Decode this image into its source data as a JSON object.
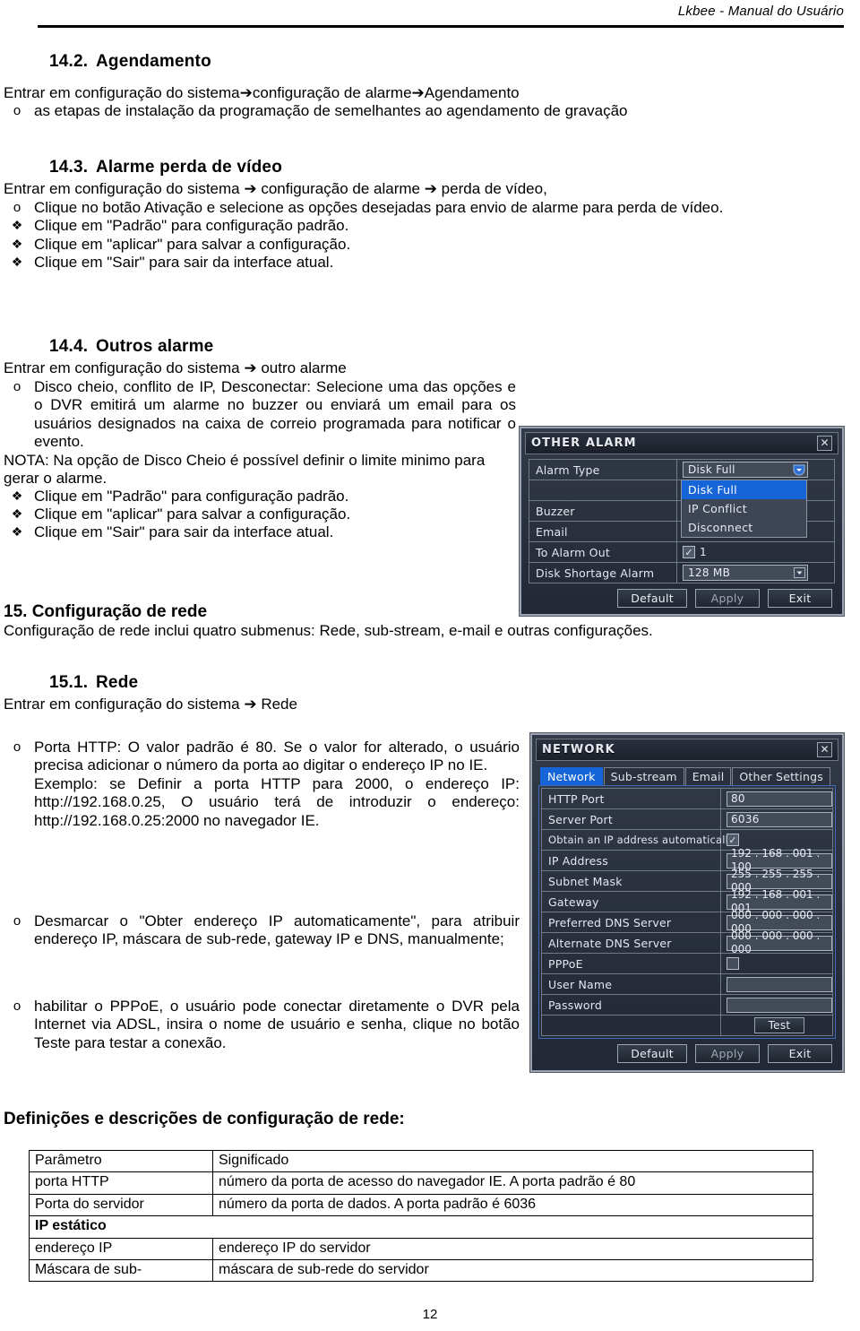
{
  "header": {
    "running_title": "Lkbee - Manual do Usuário"
  },
  "page_number": "12",
  "sections": {
    "s14_2": {
      "number": "14.2.",
      "title": "Agendamento",
      "intro": "Entrar em configuração do sistema➔configuração de alarme➔Agendamento",
      "bullets": [
        {
          "marker": "o",
          "text": "as etapas de instalação da programação de semelhantes ao agendamento de gravação"
        }
      ]
    },
    "s14_3": {
      "number": "14.3.",
      "title": "Alarme perda de vídeo",
      "intro": "Entrar em configuração do sistema ➔ configuração de alarme ➔ perda de vídeo,",
      "bullets": [
        {
          "marker": "o",
          "text": "Clique no botão Ativação e selecione as opções desejadas para envio de alarme para perda de vídeo."
        },
        {
          "marker": "❖",
          "text": "Clique em \"Padrão\" para configuração padrão."
        },
        {
          "marker": "❖",
          "text": "Clique em \"aplicar\" para salvar a configuração."
        },
        {
          "marker": "❖",
          "text": "Clique em \"Sair\" para sair da interface atual."
        }
      ]
    },
    "s14_4": {
      "number": "14.4.",
      "title": "Outros alarme",
      "intro": "Entrar em configuração do sistema ➔ outro alarme",
      "bullet_main": "Disco cheio, conflito de IP, Desconectar: Selecione uma das opções e o DVR emitirá um alarme no buzzer ou enviará um email para os usuários designados na caixa de correio programada para notificar o evento.",
      "note": "NOTA: Na opção de Disco Cheio é possível definir o limite minimo para gerar o alarme.",
      "bullets": [
        {
          "marker": "❖",
          "text": "Clique em \"Padrão\" para configuração padrão."
        },
        {
          "marker": "❖",
          "text": "Clique em \"aplicar\" para salvar a configuração."
        },
        {
          "marker": "❖",
          "text": "Clique em \"Sair\" para sair da interface atual."
        }
      ]
    },
    "s15": {
      "number": "15.",
      "title": "Configuração de rede",
      "intro": "Configuração de rede inclui quatro submenus: Rede, sub-stream, e-mail e outras configurações."
    },
    "s15_1": {
      "number": "15.1.",
      "title": "Rede",
      "intro": "Entrar em configuração do sistema ➔ Rede",
      "bullets": [
        {
          "marker": "o",
          "text": "Porta HTTP: O valor padrão é 80. Se o valor for alterado, o usuário precisa adicionar o número da porta ao digitar o endereço IP no IE."
        },
        {
          "marker": "",
          "text": "Exemplo: se  Definir a porta HTTP para 2000, o endereço IP: http://192.168.0.25, O usuário terá de introduzir o endereço: http://192.168.0.25:2000 no navegador IE."
        },
        {
          "marker": "o",
          "text": "Desmarcar o \"Obter endereço IP automaticamente\", para atribuir endereço IP, máscara de sub-rede, gateway IP e DNS, manualmente;"
        },
        {
          "marker": "o",
          "text": "habilitar o PPPoE, o usuário pode conectar diretamente o DVR pela Internet via ADSL, insira o nome de usuário e senha, clique no botão Teste para testar a conexão."
        }
      ]
    }
  },
  "table_caption": "Definições e descrições de configuração de rede:",
  "table": {
    "headers": [
      "Parâmetro",
      "Significado"
    ],
    "rows": [
      {
        "type": "normal",
        "param": "porta HTTP",
        "meaning": "número da porta de acesso do navegador IE. A porta padrão é 80"
      },
      {
        "type": "normal",
        "param": "Porta do servidor",
        "meaning": "número da porta de dados. A porta padrão é 6036"
      },
      {
        "type": "span",
        "param": "IP estático",
        "meaning": ""
      },
      {
        "type": "normal",
        "param": "endereço IP",
        "meaning": "endereço IP do servidor"
      },
      {
        "type": "normal",
        "param": "Máscara de sub-",
        "meaning": "máscara de sub-rede do servidor"
      }
    ]
  },
  "other_alarm_dialog": {
    "title": "OTHER ALARM",
    "close_label": "✕",
    "rows": [
      {
        "label": "Alarm Type",
        "value": "Disk Full",
        "control": "combo"
      },
      {
        "label": "",
        "value": "",
        "control": "none"
      },
      {
        "label": "Buzzer",
        "value": "",
        "control": "checkbox-hidden"
      },
      {
        "label": "Email",
        "value": "",
        "control": "checkbox-hidden"
      },
      {
        "label": "To Alarm Out",
        "value": "1",
        "control": "checkbox"
      },
      {
        "label": "Disk Shortage Alarm",
        "value": "128 MB",
        "control": "combo"
      }
    ],
    "dropdown_options": [
      "Disk Full",
      "IP Conflict",
      "Disconnect"
    ],
    "dropdown_selected": "Disk Full",
    "buttons": [
      "Default",
      "Apply",
      "Exit"
    ]
  },
  "network_dialog": {
    "title": "NETWORK",
    "close_label": "✕",
    "tabs": [
      "Network",
      "Sub-stream",
      "Email",
      "Other Settings"
    ],
    "active_tab": "Network",
    "rows": [
      {
        "label": "HTTP Port",
        "value": "80",
        "control": "text"
      },
      {
        "label": "Server Port",
        "value": "6036",
        "control": "text"
      },
      {
        "label": "Obtain an IP address automatically",
        "value": "",
        "control": "checkbox"
      },
      {
        "label": "IP Address",
        "value": "192 . 168 . 001 . 100",
        "control": "ipbox"
      },
      {
        "label": "Subnet Mask",
        "value": "255 . 255 . 255 . 000",
        "control": "ipbox"
      },
      {
        "label": "Gateway",
        "value": "192 . 168 . 001 . 001",
        "control": "ipbox"
      },
      {
        "label": "Preferred DNS Server",
        "value": "000 . 000 . 000 . 000",
        "control": "ipbox"
      },
      {
        "label": "Alternate DNS Server",
        "value": "000 . 000 . 000 . 000",
        "control": "ipbox"
      },
      {
        "label": "PPPoE",
        "value": "",
        "control": "checkbox-empty"
      },
      {
        "label": "User Name",
        "value": "",
        "control": "text"
      },
      {
        "label": "Password",
        "value": "",
        "control": "text"
      },
      {
        "label": "",
        "value": "Test",
        "control": "button"
      }
    ],
    "buttons": [
      "Default",
      "Apply",
      "Exit"
    ]
  },
  "colors": {
    "dialog_bg": "#1a1f2b",
    "dialog_frame": "#9aa3b0",
    "accent_blue": "#1565d8",
    "field_bg": "#434b59",
    "text_light": "#e8ecf2"
  }
}
